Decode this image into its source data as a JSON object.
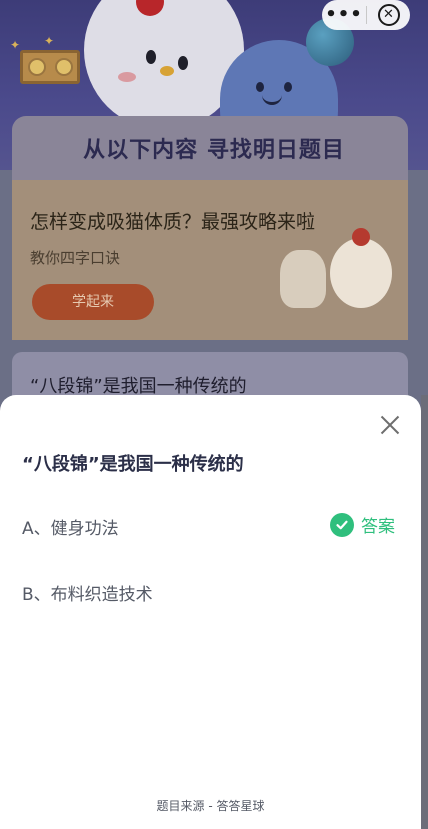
{
  "background_page": {
    "card_title": "从以下内容 寻找明日题目",
    "promo": {
      "title": "怎样变成吸猫体质？最强攻略来啦",
      "subtitle": "教你四字口诀",
      "button_label": "学起来"
    },
    "question_preview": "“八段锦”是我国一种传统的"
  },
  "capsule": {
    "more_glyph": "•••",
    "close_glyph": "✕"
  },
  "sheet": {
    "question": "“八段锦”是我国一种传统的",
    "options": [
      {
        "label": "A、健身功法",
        "is_answer": true
      },
      {
        "label": "B、布料织造技术",
        "is_answer": false
      }
    ],
    "answer_label": "答案",
    "source": "题目来源 - 答答星球"
  },
  "colors": {
    "accent_green": "#2fbf7d",
    "question_text": "#2b2f48",
    "option_text": "#555a66"
  },
  "icons": [
    "more-icon",
    "close-circle-icon",
    "close-icon",
    "check-circle-icon"
  ]
}
